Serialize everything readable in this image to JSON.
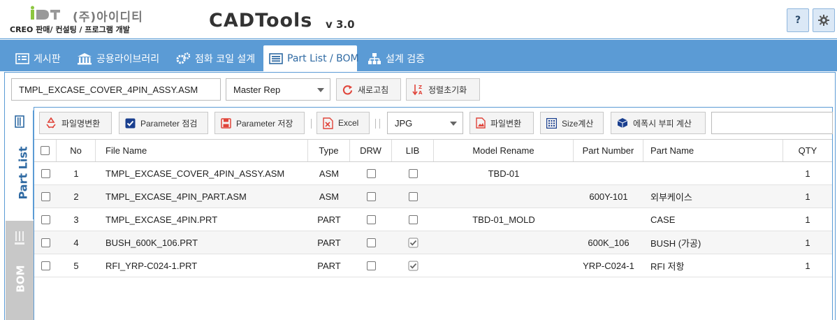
{
  "header": {
    "company": "(주)아이디티",
    "tagline": "CREO 판매/ 컨설팅 / 프로그램 개발",
    "app_name": "CADTools",
    "version": "v 3.0",
    "help_label": "?",
    "settings_icon": "gear-icon"
  },
  "tabs": [
    {
      "label": "게시판",
      "icon": "board-icon",
      "active": false
    },
    {
      "label": "공용라이브러리",
      "icon": "library-icon",
      "active": false
    },
    {
      "label": "점화 코일 설계",
      "icon": "gears-icon",
      "active": false
    },
    {
      "label": "Part List / BOM",
      "icon": "list-icon",
      "active": true
    },
    {
      "label": "설계 검증",
      "icon": "hierarchy-icon",
      "active": false
    }
  ],
  "file_bar": {
    "file_name": "TMPL_EXCASE_COVER_4PIN_ASSY.ASM",
    "rep_select": "Master Rep",
    "refresh_label": "새로고침",
    "sort_reset_label": "정렬초기화"
  },
  "toolbar": {
    "rename_label": "파일명변환",
    "param_check_label": "Parameter 점검",
    "param_save_label": "Parameter 저장",
    "excel_label": "Excel",
    "format_select": "JPG",
    "convert_label": "파일변환",
    "size_calc_label": "Size계산",
    "epoxy_label": "에폭시 부피 계산",
    "search_value": ""
  },
  "side_tabs": {
    "part_list": "Part List",
    "bom": "BOM"
  },
  "table": {
    "columns": [
      "No",
      "File Name",
      "Type",
      "DRW",
      "LIB",
      "Model Rename",
      "Part Number",
      "Part Name",
      "QTY"
    ],
    "rows": [
      {
        "no": "1",
        "file": "TMPL_EXCASE_COVER_4PIN_ASSY.ASM",
        "type": "ASM",
        "drw": false,
        "lib": false,
        "rename": "TBD-01",
        "pn": "",
        "pname": "",
        "qty": "1"
      },
      {
        "no": "2",
        "file": "TMPL_EXCASE_4PIN_PART.ASM",
        "type": "ASM",
        "drw": false,
        "lib": false,
        "rename": "",
        "pn": "600Y-101",
        "pname": "외부케이스",
        "qty": "1"
      },
      {
        "no": "3",
        "file": "TMPL_EXCASE_4PIN.PRT",
        "type": "PART",
        "drw": false,
        "lib": false,
        "rename": "TBD-01_MOLD",
        "pn": "",
        "pname": "CASE",
        "qty": "1"
      },
      {
        "no": "4",
        "file": "BUSH_600K_106.PRT",
        "type": "PART",
        "drw": false,
        "lib": true,
        "rename": "",
        "pn": "600K_106",
        "pname": "BUSH (가공)",
        "qty": "1"
      },
      {
        "no": "5",
        "file": "RFI_YRP-C024-1.PRT",
        "type": "PART",
        "drw": false,
        "lib": true,
        "rename": "",
        "pn": "YRP-C024-1",
        "pname": "RFI 저항",
        "qty": "1"
      }
    ]
  },
  "colors": {
    "accent": "#5b9bd5",
    "active_tab_text": "#2f6aa3"
  }
}
